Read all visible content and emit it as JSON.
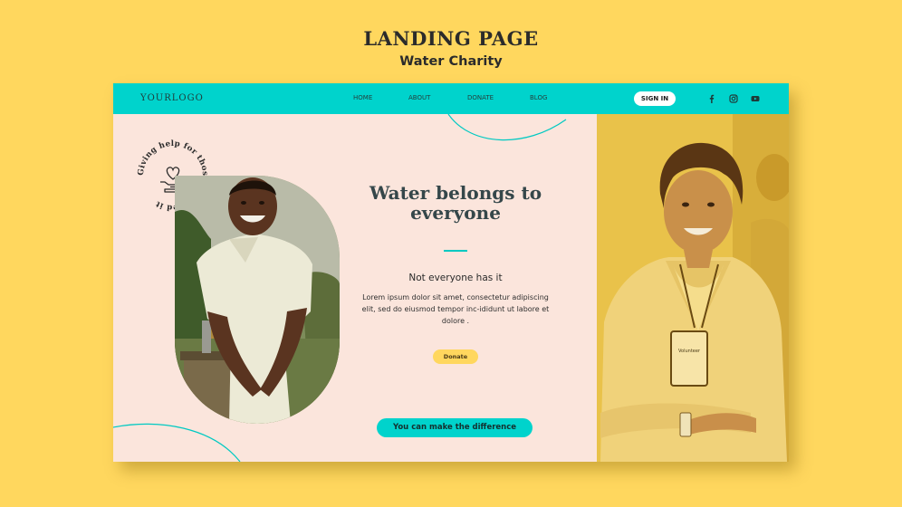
{
  "presentation": {
    "title": "LANDING PAGE",
    "subtitle": "Water Charity"
  },
  "header": {
    "logo": "YOURLOGO",
    "nav": [
      "HOME",
      "ABOUT",
      "DONATE",
      "BLOG"
    ],
    "sign_in": "SIGN IN",
    "social_icons": [
      "facebook-icon",
      "instagram-icon",
      "youtube-icon"
    ]
  },
  "badge": {
    "circular_text": "Giving help for those who need it",
    "icon": "heart-hand-icon"
  },
  "hero": {
    "headline": "Water belongs to everyone",
    "subheading": "Not everyone has it",
    "body": "Lorem ipsum dolor sit amet, consectetur adipiscing elit, sed do eiusmod tempor inc-ididunt ut labore et dolore .",
    "donate_label": "Donate",
    "cta_label": "You can  make the difference"
  },
  "photo": {
    "badge_text": "Volunteer"
  },
  "colors": {
    "background": "#ffd75e",
    "accent": "#00d3cc",
    "card": "#fbe5dc",
    "button_yellow": "#ffd75e"
  }
}
